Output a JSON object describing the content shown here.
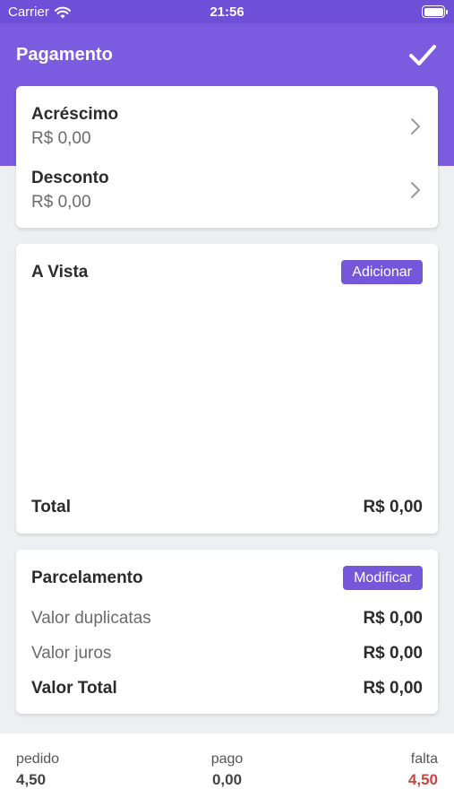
{
  "status_bar": {
    "carrier": "Carrier",
    "time": "21:56"
  },
  "header": {
    "title": "Pagamento",
    "confirm_icon": "check-icon"
  },
  "adjustments": [
    {
      "label": "Acréscimo",
      "value": "R$ 0,00"
    },
    {
      "label": "Desconto",
      "value": "R$ 0,00"
    }
  ],
  "a_vista": {
    "title": "A Vista",
    "button_label": "Adicionar",
    "total_label": "Total",
    "total_value": "R$ 0,00"
  },
  "parcelamento": {
    "title": "Parcelamento",
    "button_label": "Modificar",
    "rows": [
      {
        "label": "Valor duplicatas",
        "value": "R$ 0,00"
      },
      {
        "label": "Valor juros",
        "value": "R$ 0,00"
      },
      {
        "label": "Valor Total",
        "value": "R$ 0,00"
      }
    ]
  },
  "footer": {
    "pedido_label": "pedido",
    "pedido_value": "4,50",
    "pago_label": "pago",
    "pago_value": "0,00",
    "falta_label": "falta",
    "falta_value": "4,50",
    "falta_color": "#c9453f"
  },
  "colors": {
    "primary": "#7b5be0",
    "button": "#7657dc"
  }
}
